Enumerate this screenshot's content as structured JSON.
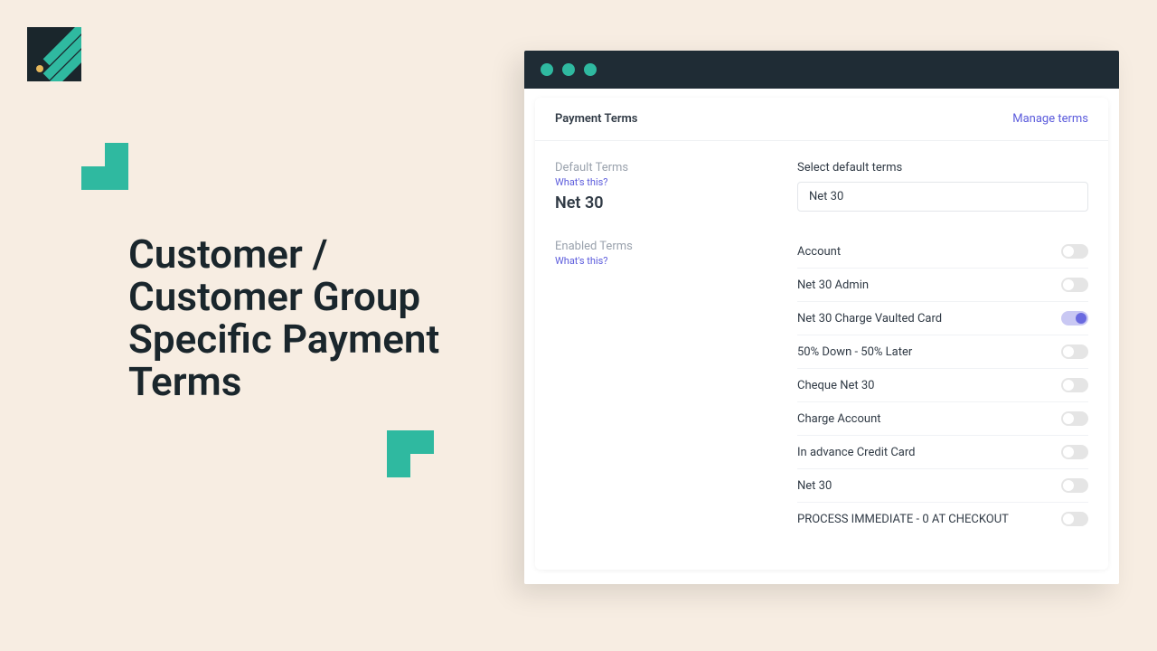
{
  "hero": {
    "title": "Customer / Customer Group Specific Payment Terms"
  },
  "card": {
    "header_label": "Payment Terms",
    "manage_link": "Manage terms"
  },
  "default_terms": {
    "label": "Default Terms",
    "whats_this": "What's this?",
    "value": "Net 30"
  },
  "enabled_terms": {
    "label": "Enabled Terms",
    "whats_this": "What's this?"
  },
  "select": {
    "label": "Select default terms",
    "value": "Net 30"
  },
  "terms": [
    {
      "name": "Account",
      "enabled": false
    },
    {
      "name": "Net 30 Admin",
      "enabled": false
    },
    {
      "name": "Net 30 Charge Vaulted Card",
      "enabled": true
    },
    {
      "name": "50% Down - 50% Later",
      "enabled": false
    },
    {
      "name": "Cheque Net 30",
      "enabled": false
    },
    {
      "name": "Charge Account",
      "enabled": false
    },
    {
      "name": "In advance Credit Card",
      "enabled": false
    },
    {
      "name": "Net 30",
      "enabled": false
    },
    {
      "name": "PROCESS IMMEDIATE - 0 AT CHECKOUT",
      "enabled": false
    }
  ],
  "colors": {
    "teal": "#2fb9a0",
    "purple": "#6a6ae0",
    "bg": "#f7ede2"
  }
}
